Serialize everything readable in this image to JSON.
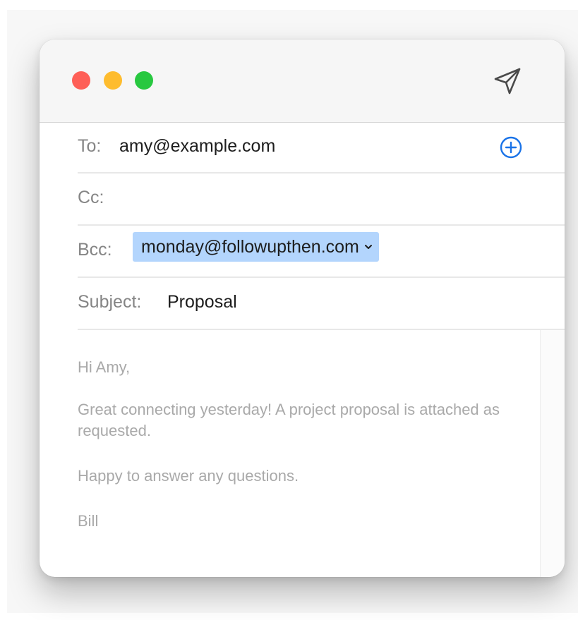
{
  "window": {
    "buttons": {
      "close_color": "#fe5f57",
      "minimize_color": "#febc2e",
      "zoom_color": "#28c840"
    },
    "send_icon": "paper-plane-icon"
  },
  "fields": {
    "to": {
      "label": "To:",
      "value": "amy@example.com",
      "add_icon": "plus-circle-icon"
    },
    "cc": {
      "label": "Cc:",
      "value": ""
    },
    "bcc": {
      "label": "Bcc:",
      "token": "monday@followupthen.com",
      "token_icon": "chevron-down-icon",
      "token_color": "#b3d5fd"
    },
    "subject": {
      "label": "Subject:",
      "value": "Proposal"
    }
  },
  "message": {
    "greeting": "Hi Amy,",
    "paragraph1": "Great connecting yesterday! A project proposal is attached as requested.",
    "paragraph2": "Happy to answer any questions.",
    "signature": "Bill"
  }
}
